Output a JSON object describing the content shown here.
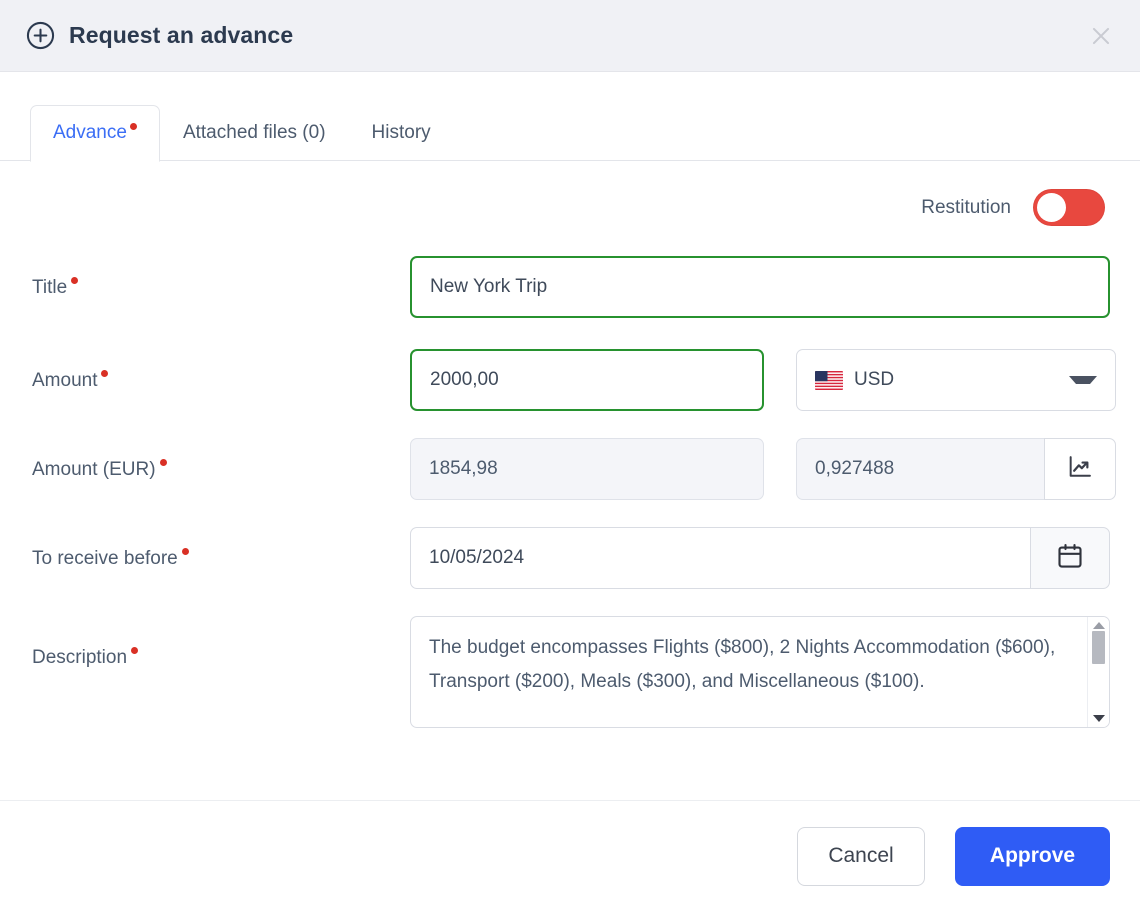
{
  "header": {
    "title": "Request an advance",
    "add_icon": "plus-circle-icon",
    "close_icon": "close-icon"
  },
  "tabs": [
    {
      "label": "Advance",
      "active": true,
      "required_dot": true
    },
    {
      "label": "Attached files (0)",
      "active": false,
      "required_dot": false
    },
    {
      "label": "History",
      "active": false,
      "required_dot": false
    }
  ],
  "restitution": {
    "label": "Restitution",
    "enabled": false,
    "color": "#e8483f"
  },
  "form": {
    "title": {
      "label": "Title",
      "required": true,
      "value": "New York Trip",
      "state": "valid"
    },
    "amount": {
      "label": "Amount",
      "required": true,
      "value": "2000,00",
      "state": "valid",
      "currency": {
        "code": "USD",
        "flag": "us-flag-icon"
      }
    },
    "amount_eur": {
      "label": "Amount (EUR)",
      "required": true,
      "value": "1854,98",
      "rate": "0,927488",
      "rate_icon": "chart-line-up-icon",
      "readonly": true
    },
    "receive_before": {
      "label": "To receive before",
      "required": true,
      "value": "10/05/2024",
      "calendar_icon": "calendar-icon"
    },
    "description": {
      "label": "Description",
      "required": true,
      "value": "The budget encompasses Flights ($800), 2 Nights Accommodation ($600), Transport ($200), Meals ($300), and Miscellaneous ($100).",
      "scrollbar": {
        "up_icon": "scroll-up-arrow-icon",
        "down_icon": "scroll-down-arrow-icon"
      }
    }
  },
  "footer": {
    "cancel_label": "Cancel",
    "approve_label": "Approve",
    "approve_color": "#2f5cf5"
  }
}
